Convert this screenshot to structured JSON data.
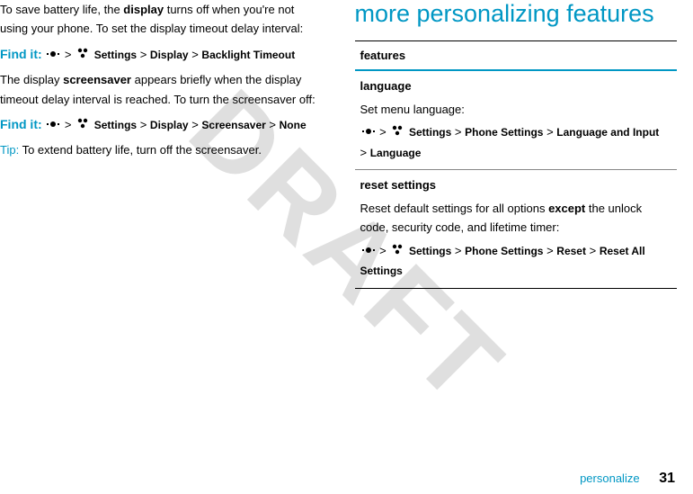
{
  "watermark": "DRAFT",
  "left": {
    "intro_pre": "To save battery life, the ",
    "intro_bold": "display",
    "intro_post": " turns off when you're not using your phone. To set the display timeout delay interval:",
    "findit1_label": "Find it:",
    "path1": {
      "settings": "Settings",
      "display": "Display",
      "backlight": "Backlight Timeout"
    },
    "screensaver_pre": "The display ",
    "screensaver_bold": "screensaver",
    "screensaver_post": " appears briefly when the display timeout delay interval is reached. To turn the screensaver off:",
    "findit2_label": "Find it:",
    "path2": {
      "settings": "Settings",
      "display": "Display",
      "screensaver": "Screensaver",
      "none": "None"
    },
    "tip_label": "Tip:",
    "tip_text": " To extend battery life, turn off the screensaver."
  },
  "right": {
    "heading": "more personalizing features",
    "table_header": "features",
    "row1": {
      "title": "language",
      "desc": "Set menu language:",
      "path": {
        "settings": "Settings",
        "phone": "Phone Settings",
        "langinput": "Language and Input",
        "language": "Language"
      }
    },
    "row2": {
      "title": "reset settings",
      "desc_pre": "Reset default settings for all options ",
      "desc_bold": "except",
      "desc_post": " the unlock code, security code, and lifetime timer:",
      "path": {
        "settings": "Settings",
        "phone": "Phone Settings",
        "reset": "Reset",
        "resetall": "Reset All Settings"
      }
    }
  },
  "footer": {
    "label": "personalize",
    "page": "31"
  }
}
